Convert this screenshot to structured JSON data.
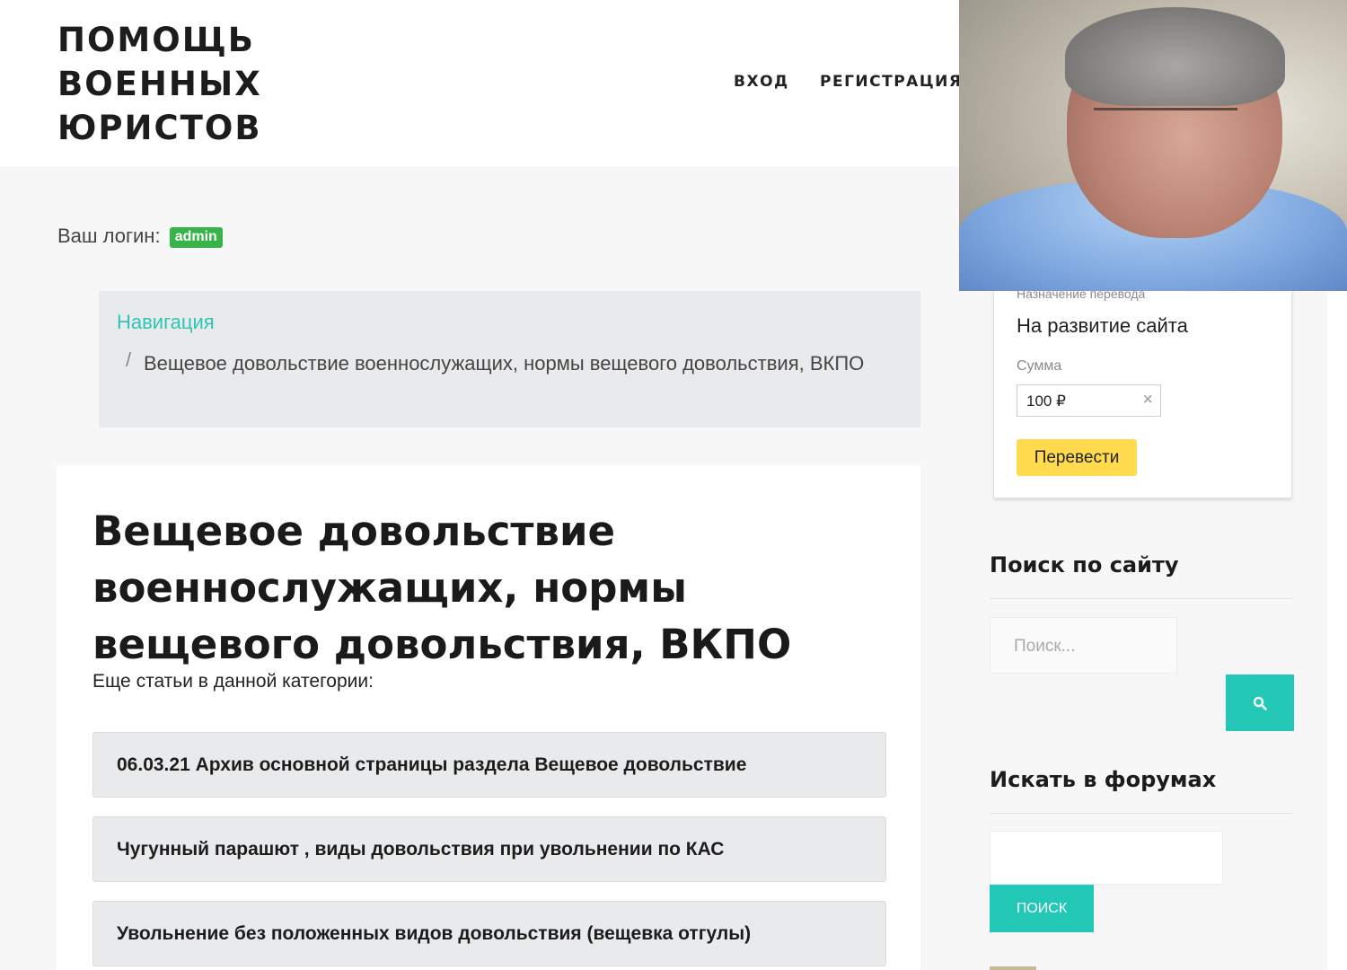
{
  "header": {
    "site_title": "ПОМОЩЬ\nВОЕННЫХ\nЮРИСТОВ",
    "nav": {
      "login": "ВХОД",
      "register": "РЕГИСТРАЦИЯ"
    }
  },
  "login_info": {
    "label": "Ваш логин:",
    "username": "admin"
  },
  "breadcrumb": {
    "root": "Навигация",
    "separator": "/",
    "current": "Вещевое довольствие военнослужащих, нормы вещевого довольствия, ВКПО"
  },
  "article": {
    "title": "Вещевое довольствие военнослужащих, нормы вещевого довольствия, ВКПО",
    "more_label": "Еще статьи в данной категории:",
    "related": [
      "06.03.21 Архив основной страницы раздела Вещевое довольствие",
      "Чугунный парашют , виды довольствия при увольнении по КАС",
      "Увольнение без положенных видов довольствия (вещевка отгулы)"
    ]
  },
  "donate": {
    "purpose_label": "Назначение перевода",
    "purpose": "На развитие сайта",
    "sum_label": "Сумма",
    "sum_value": "100 ₽",
    "button": "Перевести",
    "button_color": "#ffdb4d"
  },
  "sidebar": {
    "site_search": {
      "title": "Поиск по сайту",
      "placeholder": "Поиск..."
    },
    "forum_search": {
      "title": "Искать в форумах",
      "button": "ПОИСК"
    }
  },
  "colors": {
    "accent": "#22c7b5",
    "badge": "#37b34a",
    "link": "#30c4b4"
  },
  "icons": {
    "search": "search-icon",
    "clear": "close-icon"
  }
}
